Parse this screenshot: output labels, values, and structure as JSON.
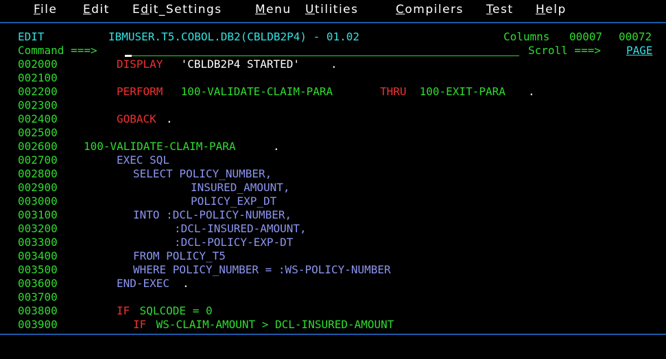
{
  "menu": {
    "items": [
      {
        "mnemonic": "F",
        "rest": "ile"
      },
      {
        "mnemonic": "E",
        "rest": "dit"
      },
      {
        "pre": "E",
        "mnemonic": "d",
        "rest": "it_Settings"
      },
      {
        "mnemonic": "M",
        "rest": "enu"
      },
      {
        "mnemonic": "U",
        "rest": "tilities"
      },
      {
        "mnemonic": "C",
        "rest": "ompilers"
      },
      {
        "mnemonic": "T",
        "rest": "est"
      },
      {
        "mnemonic": "H",
        "rest": "elp"
      }
    ]
  },
  "header": {
    "mode": "EDIT",
    "dataset": "IBMUSER.T5.COBOL.DB2(CBLDB2P4) - 01.02",
    "columns_label": "Columns",
    "col_from": "00007",
    "col_to": "00072",
    "command_label": "Command ===>",
    "command_value": "",
    "scroll_label": "Scroll ===>",
    "scroll_value": "PAGE"
  },
  "lines": [
    {
      "num": "002000",
      "a": "DISPLAY",
      "b": " 'CBLDB2P4 STARTED'",
      "c": "."
    },
    {
      "num": "002100"
    },
    {
      "num": "002200",
      "a": "PERFORM",
      "b": " 100-VALIDATE-CLAIM-PARA ",
      "c": "THRU",
      "d": " 100-EXIT-PARA",
      "e": "."
    },
    {
      "num": "002300"
    },
    {
      "num": "002400",
      "a": "GOBACK",
      "b": "."
    },
    {
      "num": "002500"
    },
    {
      "num": "002600",
      "a": "100-VALIDATE-CLAIM-PARA",
      "b": "."
    },
    {
      "num": "002700",
      "a": "EXEC SQL"
    },
    {
      "num": "002800",
      "a": "SELECT POLICY_NUMBER,"
    },
    {
      "num": "002900",
      "a": "INSURED_AMOUNT,"
    },
    {
      "num": "003000",
      "a": "POLICY_EXP_DT"
    },
    {
      "num": "003100",
      "a": "INTO :DCL-POLICY-NUMBER,"
    },
    {
      "num": "003200",
      "a": ":DCL-INSURED-AMOUNT,"
    },
    {
      "num": "003300",
      "a": ":DCL-POLICY-EXP-DT"
    },
    {
      "num": "003400",
      "a": "FROM POLICY_T5"
    },
    {
      "num": "003500",
      "a": "WHERE POLICY_NUMBER = :WS-POLICY-NUMBER"
    },
    {
      "num": "003600",
      "a": "END-EXEC",
      "b": "."
    },
    {
      "num": "003700"
    },
    {
      "num": "003800",
      "a": "IF",
      "b": " SQLCODE = 0"
    },
    {
      "num": "003900",
      "a": "IF",
      "b": " WS-CLAIM-AMOUNT > DCL-INSURED-AMOUNT"
    }
  ],
  "colors": {
    "background": "#000000",
    "line_numbers": "#2fdc2f",
    "keyword": "#f03030",
    "sql": "#8c95f0",
    "text": "#ffffff",
    "header": "#33e0e0",
    "separator": "#1e5aa8"
  }
}
